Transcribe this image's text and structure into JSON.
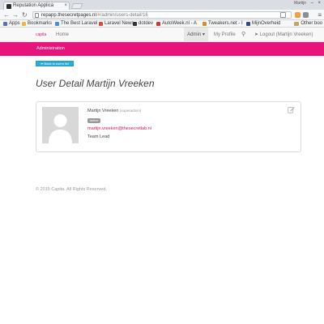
{
  "browser": {
    "tab_title": "Reputation Applica",
    "profile_label": "Martijn",
    "url_host": "repapp.thesecretpages.nl",
    "url_path": "/#/admin/users-detail/16",
    "bookmarks": [
      {
        "label": "Apps",
        "color": "#5a6fb8"
      },
      {
        "label": "Bookmarks",
        "color": "#f2b43a"
      },
      {
        "label": "The Best Laravel",
        "color": "#4b8be6"
      },
      {
        "label": "Laravel News",
        "color": "#e5473a"
      },
      {
        "label": "dotdev",
        "color": "#333333"
      },
      {
        "label": "AutoWeek.nl - A",
        "color": "#d7322e"
      },
      {
        "label": "Tweakers.net - I",
        "color": "#e08a2a"
      },
      {
        "label": "MijnOverheid",
        "color": "#2d4b8c"
      }
    ],
    "other_bookmarks": "Other boo"
  },
  "app": {
    "brand": "capita",
    "nav": {
      "home": "Home",
      "admin": "Admin ▾",
      "profile": "My Profile",
      "logout": "Logout (Martijn Vreeken)"
    },
    "admin_bar": "Administration",
    "back_button": "⬅ Back to users list",
    "page_title": "User Detail Martijn Vreeken",
    "user": {
      "name": "Martijn Vreeken",
      "handle": "(superadmin)",
      "status": "active",
      "email": "martijn.vreeken@thesecretlab.nl",
      "role": "Team Lead"
    },
    "footer": "© 2015 Capita. All Rights Reserved."
  },
  "colors": {
    "accent": "#e6147b",
    "button": "#2aaed9",
    "email": "#d9114e"
  }
}
